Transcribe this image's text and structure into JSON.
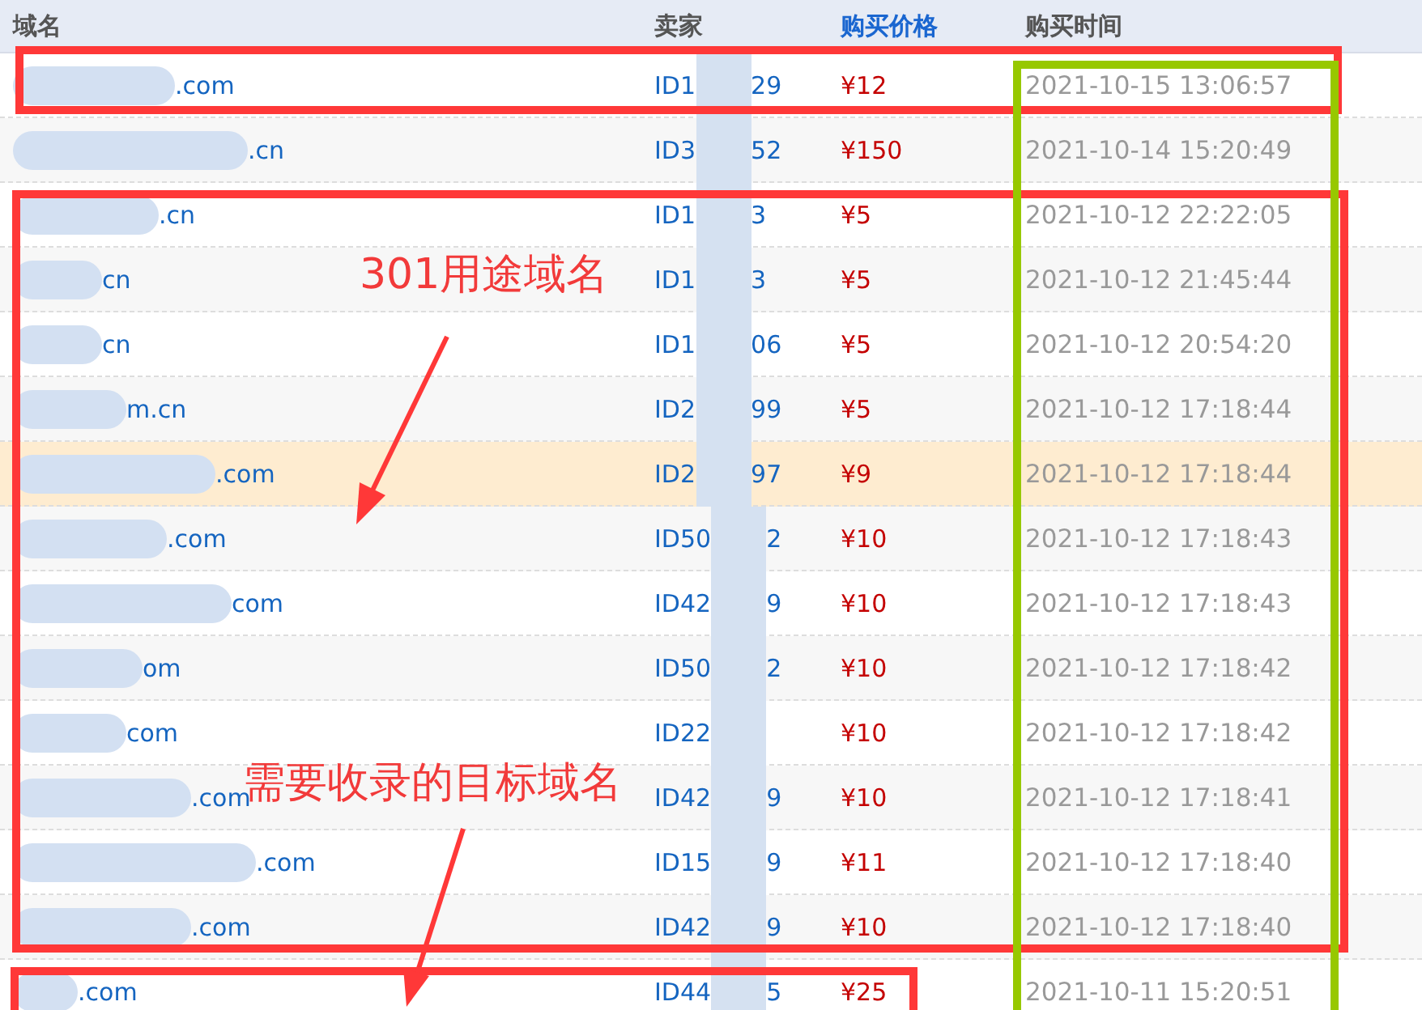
{
  "table": {
    "columns": [
      {
        "label": "域名",
        "sorted": false
      },
      {
        "label": "卖家",
        "sorted": false
      },
      {
        "label": "购买价格",
        "sorted": true
      },
      {
        "label": "购买时间",
        "sorted": false
      }
    ],
    "rows": [
      {
        "domain": ".com",
        "seller_start": "ID1",
        "seller_end": "29",
        "price": "¥12",
        "time": "2021-10-15 13:06:57",
        "highlighted": false
      },
      {
        "domain": ".cn",
        "seller_start": "ID3",
        "seller_end": "52",
        "price": "¥150",
        "time": "2021-10-14 15:20:49",
        "highlighted": false
      },
      {
        "domain": ".cn",
        "seller_start": "ID1",
        "seller_end": "3",
        "price": "¥5",
        "time": "2021-10-12 22:22:05",
        "highlighted": false
      },
      {
        "domain": "cn",
        "seller_start": "ID1",
        "seller_end": "3",
        "price": "¥5",
        "time": "2021-10-12 21:45:44",
        "highlighted": false
      },
      {
        "domain": "cn",
        "seller_start": "ID1",
        "seller_end": "06",
        "price": "¥5",
        "time": "2021-10-12 20:54:20",
        "highlighted": false
      },
      {
        "domain": "m.cn",
        "seller_start": "ID2",
        "seller_end": "99",
        "price": "¥5",
        "time": "2021-10-12 17:18:44",
        "highlighted": false
      },
      {
        "domain": ".com",
        "seller_start": "ID2",
        "seller_end": "97",
        "price": "¥9",
        "time": "2021-10-12 17:18:44",
        "highlighted": true
      },
      {
        "domain": ".com",
        "seller_start": "ID50",
        "seller_end": "2",
        "price": "¥10",
        "time": "2021-10-12 17:18:43",
        "highlighted": false
      },
      {
        "domain": "com",
        "seller_start": "ID42",
        "seller_end": "9",
        "price": "¥10",
        "time": "2021-10-12 17:18:43",
        "highlighted": false
      },
      {
        "domain": "om",
        "seller_start": "ID50",
        "seller_end": "2",
        "price": "¥10",
        "time": "2021-10-12 17:18:42",
        "highlighted": false
      },
      {
        "domain": "com",
        "seller_start": "ID22",
        "seller_end": "",
        "price": "¥10",
        "time": "2021-10-12 17:18:42",
        "highlighted": false
      },
      {
        "domain": ".com",
        "seller_start": "ID42",
        "seller_end": "9",
        "price": "¥10",
        "time": "2021-10-12 17:18:41",
        "highlighted": false
      },
      {
        "domain": ".com",
        "seller_start": "ID15",
        "seller_end": "9",
        "price": "¥11",
        "time": "2021-10-12 17:18:40",
        "highlighted": false
      },
      {
        "domain": ".com",
        "seller_start": "ID42",
        "seller_end": "9",
        "price": "¥10",
        "time": "2021-10-12 17:18:40",
        "highlighted": false
      },
      {
        "domain": ".com",
        "seller_start": "ID44",
        "seller_end": "5",
        "price": "¥25",
        "time": "2021-10-11 15:20:51",
        "highlighted": false
      }
    ]
  },
  "annotations": {
    "labels": [
      "301用途域名",
      "需要收录的目标域名"
    ]
  }
}
